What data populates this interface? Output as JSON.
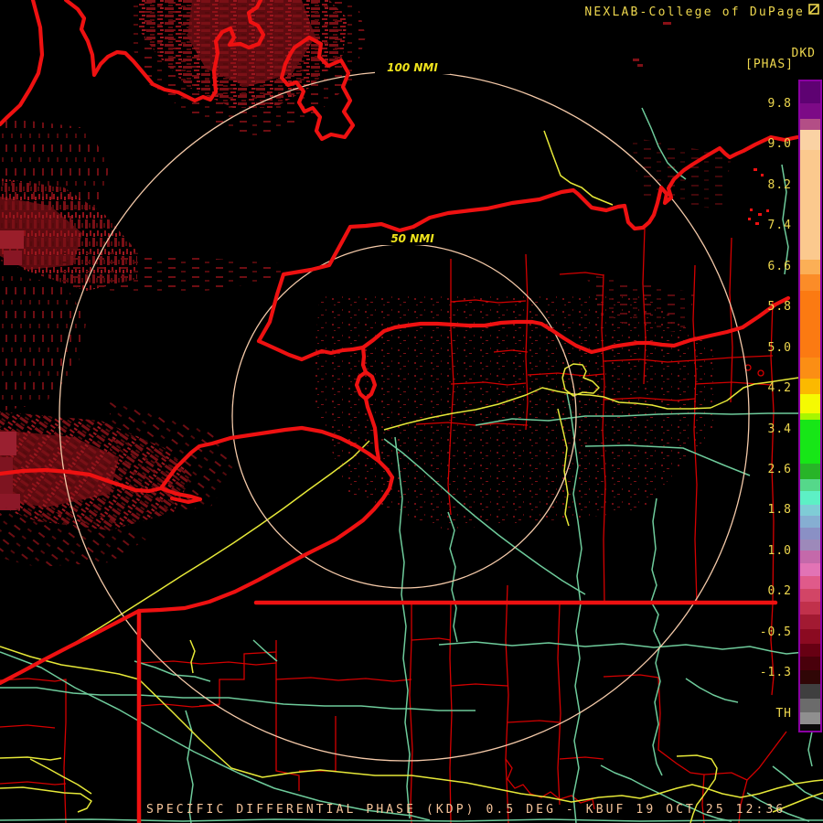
{
  "header": {
    "title": "NEXLAB-College of DuPage",
    "logo_icon": "cod-logo-icon"
  },
  "colorbar": {
    "units_label": "DKD",
    "phase_label": "[PHAS]",
    "border_color": "#8a00a2",
    "ticks": [
      [
        "9.8",
        114
      ],
      [
        "9.0",
        158
      ],
      [
        "8.2",
        203
      ],
      [
        "7.4",
        247
      ],
      [
        "6.6",
        292
      ],
      [
        "5.8",
        336
      ],
      [
        "5.0",
        381
      ],
      [
        "4.2",
        425
      ],
      [
        "3.4",
        470
      ],
      [
        "2.6",
        514
      ],
      [
        "1.8",
        558
      ],
      [
        "1.0",
        603
      ],
      [
        "0.2",
        647
      ],
      [
        "-0.5",
        692
      ],
      [
        "-1.3",
        736
      ],
      [
        "TH",
        781
      ]
    ],
    "segments": [
      [
        "#5e0272",
        24
      ],
      [
        "#7c0a86",
        17
      ],
      [
        "#b34e86",
        12
      ],
      [
        "#fad2a4",
        22
      ],
      [
        "#fbc98e",
        120
      ],
      [
        "#fbaf56",
        16
      ],
      [
        "#fb8c28",
        18
      ],
      [
        "#fb7a12",
        73
      ],
      [
        "#fb8e14",
        23
      ],
      [
        "#fbb900",
        17
      ],
      [
        "#f5fa02",
        21
      ],
      [
        "#a8f500",
        7
      ],
      [
        "#17e617",
        48
      ],
      [
        "#28b428",
        17
      ],
      [
        "#55d88a",
        13
      ],
      [
        "#5df0c5",
        15
      ],
      [
        "#7fccd6",
        12
      ],
      [
        "#86aed2",
        13
      ],
      [
        "#8a90c5",
        13
      ],
      [
        "#9d89ba",
        12
      ],
      [
        "#c469aa",
        14
      ],
      [
        "#e273b5",
        14
      ],
      [
        "#e05a8a",
        14
      ],
      [
        "#d24566",
        14
      ],
      [
        "#c1314b",
        14
      ],
      [
        "#a21a32",
        16
      ],
      [
        "#8b0a21",
        16
      ],
      [
        "#670013",
        14
      ],
      [
        "#49000b",
        15
      ],
      [
        "#300606",
        15
      ],
      [
        "#3f3f3f",
        16
      ],
      [
        "#6b6b6b",
        15
      ],
      [
        "#8f8f8f",
        13
      ],
      [
        "#0a0a0a",
        7
      ]
    ]
  },
  "rings": {
    "outer_label": "100 NMI",
    "inner_label": "50 NMI",
    "ring_color": "#f4c9a8",
    "label_color": "#f0e41c"
  },
  "footer": {
    "caption": "SPECIFIC DIFFERENTIAL PHASE (KDP) 0.5 DEG - KBUF 19 OCT 25 12:36"
  },
  "map_colors": {
    "background": "#000000",
    "boundary_thick_red": "#ee1111",
    "county_red": "#d40000",
    "road_teal": "#6ecb9b",
    "road_yellow": "#e6e838",
    "echo_dark_red": "#7a1016",
    "text_yellow": "#eed74e",
    "caption_peach": "#f6c49a"
  }
}
